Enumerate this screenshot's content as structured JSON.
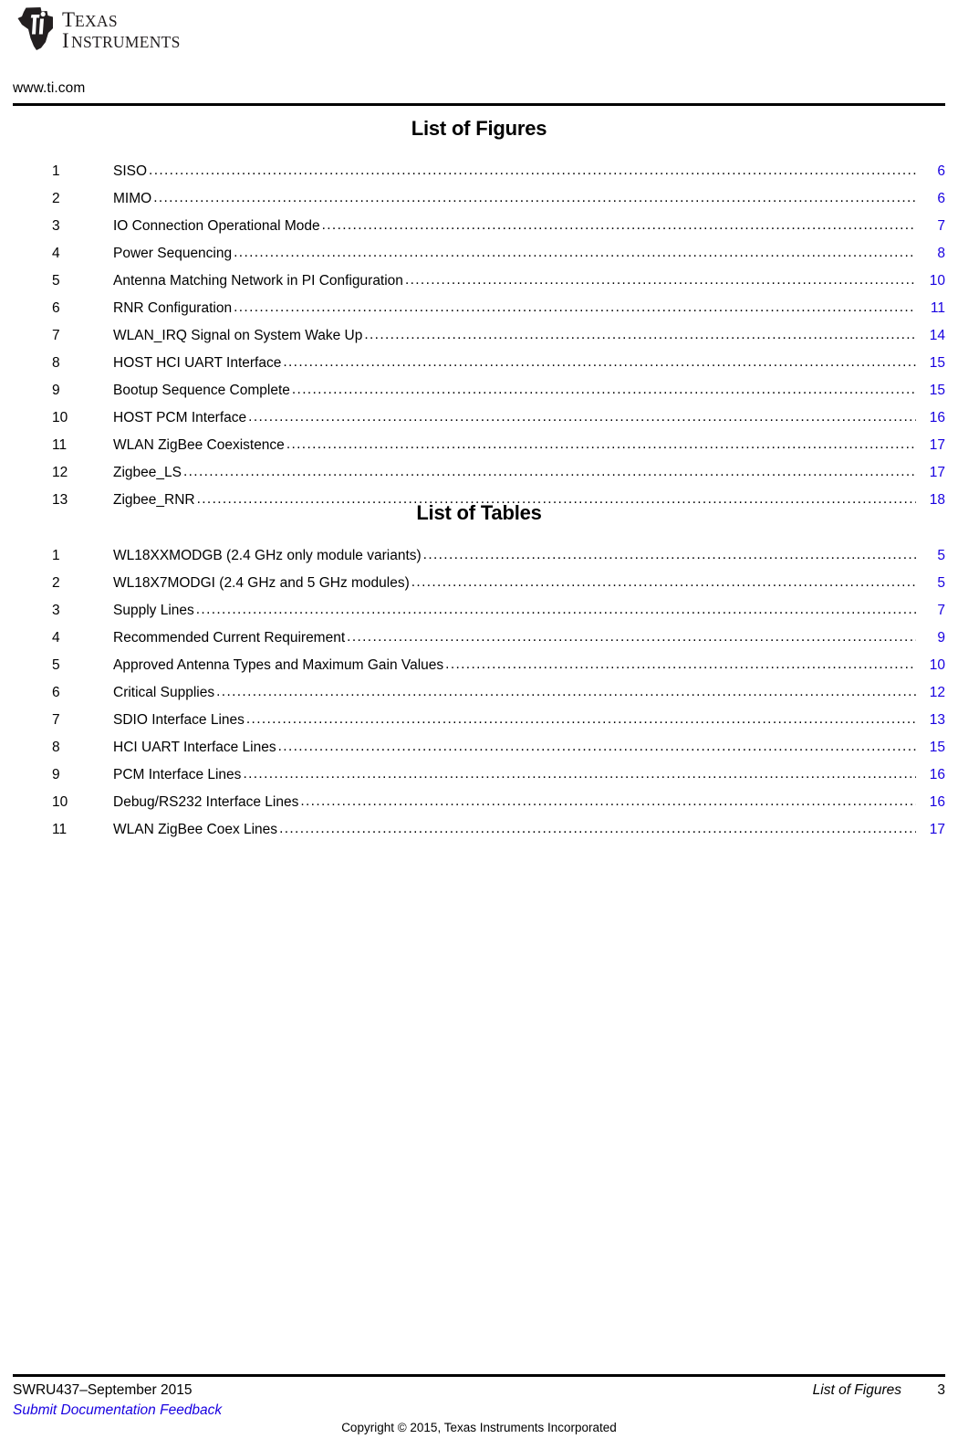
{
  "header": {
    "logo_alt": "Texas Instruments",
    "logo_line1": "TEXAS",
    "logo_line2": "INSTRUMENTS",
    "site_url": "www.ti.com"
  },
  "figures_section": {
    "title": "List of Figures",
    "entries": [
      {
        "num": "1",
        "label": "SISO",
        "page": "6"
      },
      {
        "num": "2",
        "label": "MIMO",
        "page": "6"
      },
      {
        "num": "3",
        "label": "IO Connection Operational Mode",
        "page": "7"
      },
      {
        "num": "4",
        "label": "Power Sequencing",
        "page": "8"
      },
      {
        "num": "5",
        "label": "Antenna Matching Network in PI Configuration",
        "page": "10"
      },
      {
        "num": "6",
        "label": "RNR Configuration",
        "page": "11"
      },
      {
        "num": "7",
        "label": "WLAN_IRQ Signal on System Wake Up",
        "page": "14"
      },
      {
        "num": "8",
        "label": "HOST HCI UART Interface",
        "page": "15"
      },
      {
        "num": "9",
        "label": "Bootup Sequence Complete",
        "page": "15"
      },
      {
        "num": "10",
        "label": "HOST PCM Interface",
        "page": "16"
      },
      {
        "num": "11",
        "label": "WLAN ZigBee Coexistence",
        "page": "17"
      },
      {
        "num": "12",
        "label": "Zigbee_LS",
        "page": "17"
      },
      {
        "num": "13",
        "label": "Zigbee_RNR",
        "page": "18"
      }
    ]
  },
  "tables_section": {
    "title": "List of Tables",
    "entries": [
      {
        "num": "1",
        "label": "WL18XXMODGB (2.4 GHz only module variants)",
        "page": "5"
      },
      {
        "num": "2",
        "label": "WL18X7MODGI (2.4 GHz and 5 GHz modules)",
        "page": "5"
      },
      {
        "num": "3",
        "label": "Supply Lines",
        "page": "7"
      },
      {
        "num": "4",
        "label": "Recommended Current Requirement",
        "page": "9"
      },
      {
        "num": "5",
        "label": "Approved Antenna Types and Maximum Gain Values",
        "page": "10"
      },
      {
        "num": "6",
        "label": "Critical Supplies",
        "page": "12"
      },
      {
        "num": "7",
        "label": "SDIO Interface Lines",
        "page": "13"
      },
      {
        "num": "8",
        "label": "HCI UART Interface Lines",
        "page": "15"
      },
      {
        "num": "9",
        "label": "PCM Interface Lines",
        "page": "16"
      },
      {
        "num": "10",
        "label": "Debug/RS232 Interface Lines",
        "page": "16"
      },
      {
        "num": "11",
        "label": "WLAN ZigBee Coex Lines",
        "page": "17"
      }
    ]
  },
  "footer": {
    "doc_id": "SWRU437–September 2015",
    "feedback_link": "Submit Documentation Feedback",
    "section_name": "List of Figures",
    "page_number": "3",
    "copyright": "Copyright © 2015, Texas Instruments Incorporated"
  },
  "leader_char": ".",
  "colors": {
    "link_blue": "#1800e0",
    "text_black": "#000000",
    "rule_black": "#000000"
  }
}
